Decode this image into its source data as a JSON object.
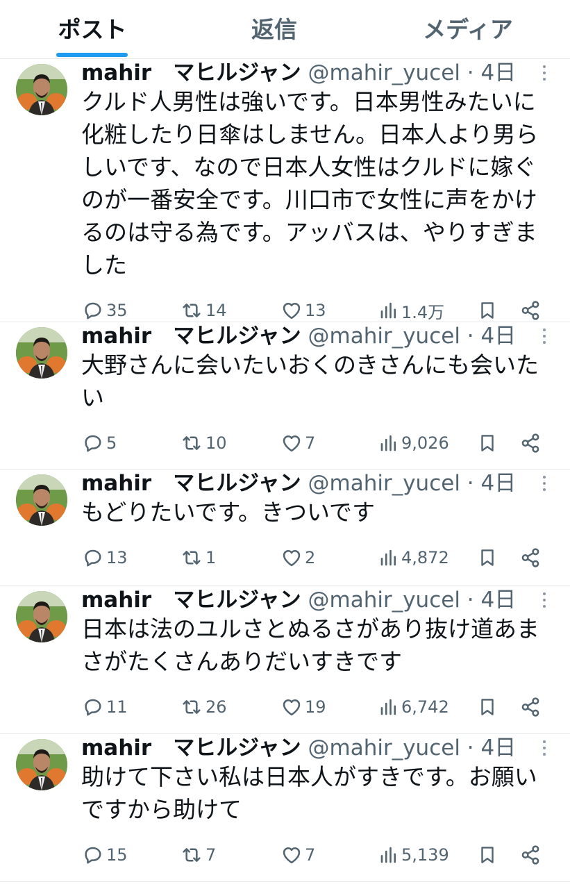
{
  "tabs": [
    {
      "label": "ポスト",
      "active": true
    },
    {
      "label": "返信",
      "active": false
    },
    {
      "label": "メディア",
      "active": false
    }
  ],
  "author": {
    "name": "mahir　マヒルジャン",
    "handle": "@mahir_yucel",
    "separator": "·"
  },
  "tweets": [
    {
      "time": "4日",
      "text": "クルド人男性は強いです。日本男性みたいに化粧したり日傘はしません。日本人より男らしいです、なので日本人女性はクルドに嫁ぐのが一番安全です。川口市で女性に声をかけるのは守る為です。アッバスは、やりすぎました",
      "replies": "35",
      "reposts": "14",
      "likes": "13",
      "views": "1.4万"
    },
    {
      "time": "4日",
      "text": "大野さんに会いたいおくのきさんにも会いたい",
      "replies": "5",
      "reposts": "10",
      "likes": "7",
      "views": "9,026"
    },
    {
      "time": "4日",
      "text": "もどりたいです。きついです",
      "replies": "13",
      "reposts": "1",
      "likes": "2",
      "views": "4,872"
    },
    {
      "time": "4日",
      "text": "日本は法のユルさとぬるさがあり抜け道あまさがたくさんありだいすきです",
      "replies": "11",
      "reposts": "26",
      "likes": "19",
      "views": "6,742"
    },
    {
      "time": "4日",
      "text": "助けて下さい私は日本人がすきです。お願いですから助けて",
      "replies": "15",
      "reposts": "7",
      "likes": "7",
      "views": "5,139"
    }
  ],
  "colors": {
    "accent": "#1d9bf0",
    "text": "#0f1419",
    "muted": "#536471",
    "divider": "#e6e9ec"
  },
  "icons": {
    "reply": "speech-bubble-icon",
    "repost": "repost-arrows-icon",
    "like": "heart-icon",
    "views": "bar-chart-icon",
    "bookmark": "bookmark-icon",
    "share": "share-icon",
    "more": "more-vertical-icon"
  }
}
